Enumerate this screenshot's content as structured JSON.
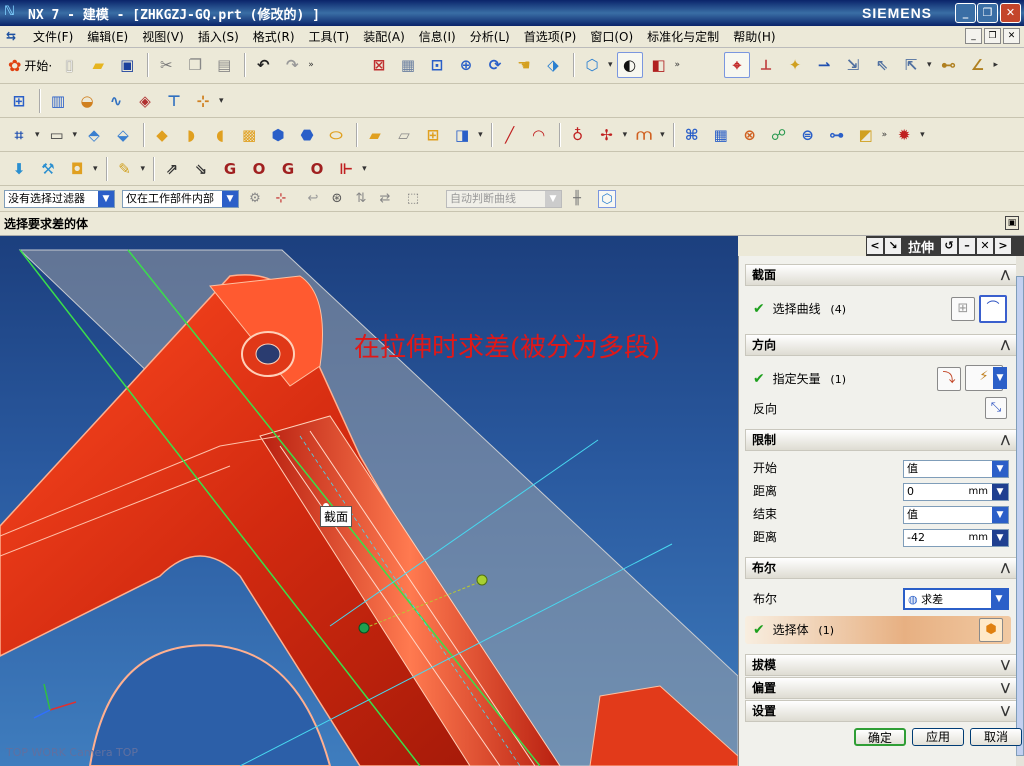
{
  "window": {
    "title": "NX 7 - 建模 - [ZHKGZJ-GQ.prt  (修改的) ]",
    "brand": "SIEMENS",
    "controls": [
      "_",
      "❐",
      "✕"
    ]
  },
  "menu": {
    "items": [
      "文件(F)",
      "编辑(E)",
      "视图(V)",
      "插入(S)",
      "格式(R)",
      "工具(T)",
      "装配(A)",
      "信息(I)",
      "分析(L)",
      "首选项(P)",
      "窗口(O)",
      "标准化与定制",
      "帮助(H)"
    ],
    "mdi_controls": [
      "_",
      "❐",
      "✕"
    ]
  },
  "toolbar": {
    "start_label": "开始·"
  },
  "filter": {
    "type_filter": "没有选择过滤器",
    "scope": "仅在工作部件内部",
    "curve_rule": "自动判断曲线"
  },
  "cue": {
    "text": "选择要求差的体"
  },
  "viewport": {
    "annotation": "在拉伸时求差(被分为多段)",
    "section_label": "截面",
    "view_label": "TOP WORK Camera TOP"
  },
  "dialog": {
    "title": "拉伸",
    "sections": {
      "section": {
        "header": "截面",
        "select_curve_label": "选择曲线",
        "select_curve_count": "(4)"
      },
      "direction": {
        "header": "方向",
        "vector_label": "指定矢量",
        "vector_count": "(1)",
        "reverse_label": "反向"
      },
      "limits": {
        "header": "限制",
        "start_label": "开始",
        "start_value": "值",
        "start_dist_label": "距离",
        "start_dist_value": "0",
        "end_label": "结束",
        "end_value": "值",
        "end_dist_label": "距离",
        "end_dist_value": "-42",
        "unit": "mm"
      },
      "boolean": {
        "header": "布尔",
        "label": "布尔",
        "value": "求差",
        "select_body_label": "选择体",
        "select_body_count": "(1)"
      },
      "draft": {
        "header": "拔模"
      },
      "offset": {
        "header": "偏置"
      },
      "settings": {
        "header": "设置"
      }
    },
    "buttons": {
      "ok": "确定",
      "apply": "应用",
      "cancel": "取消"
    }
  }
}
